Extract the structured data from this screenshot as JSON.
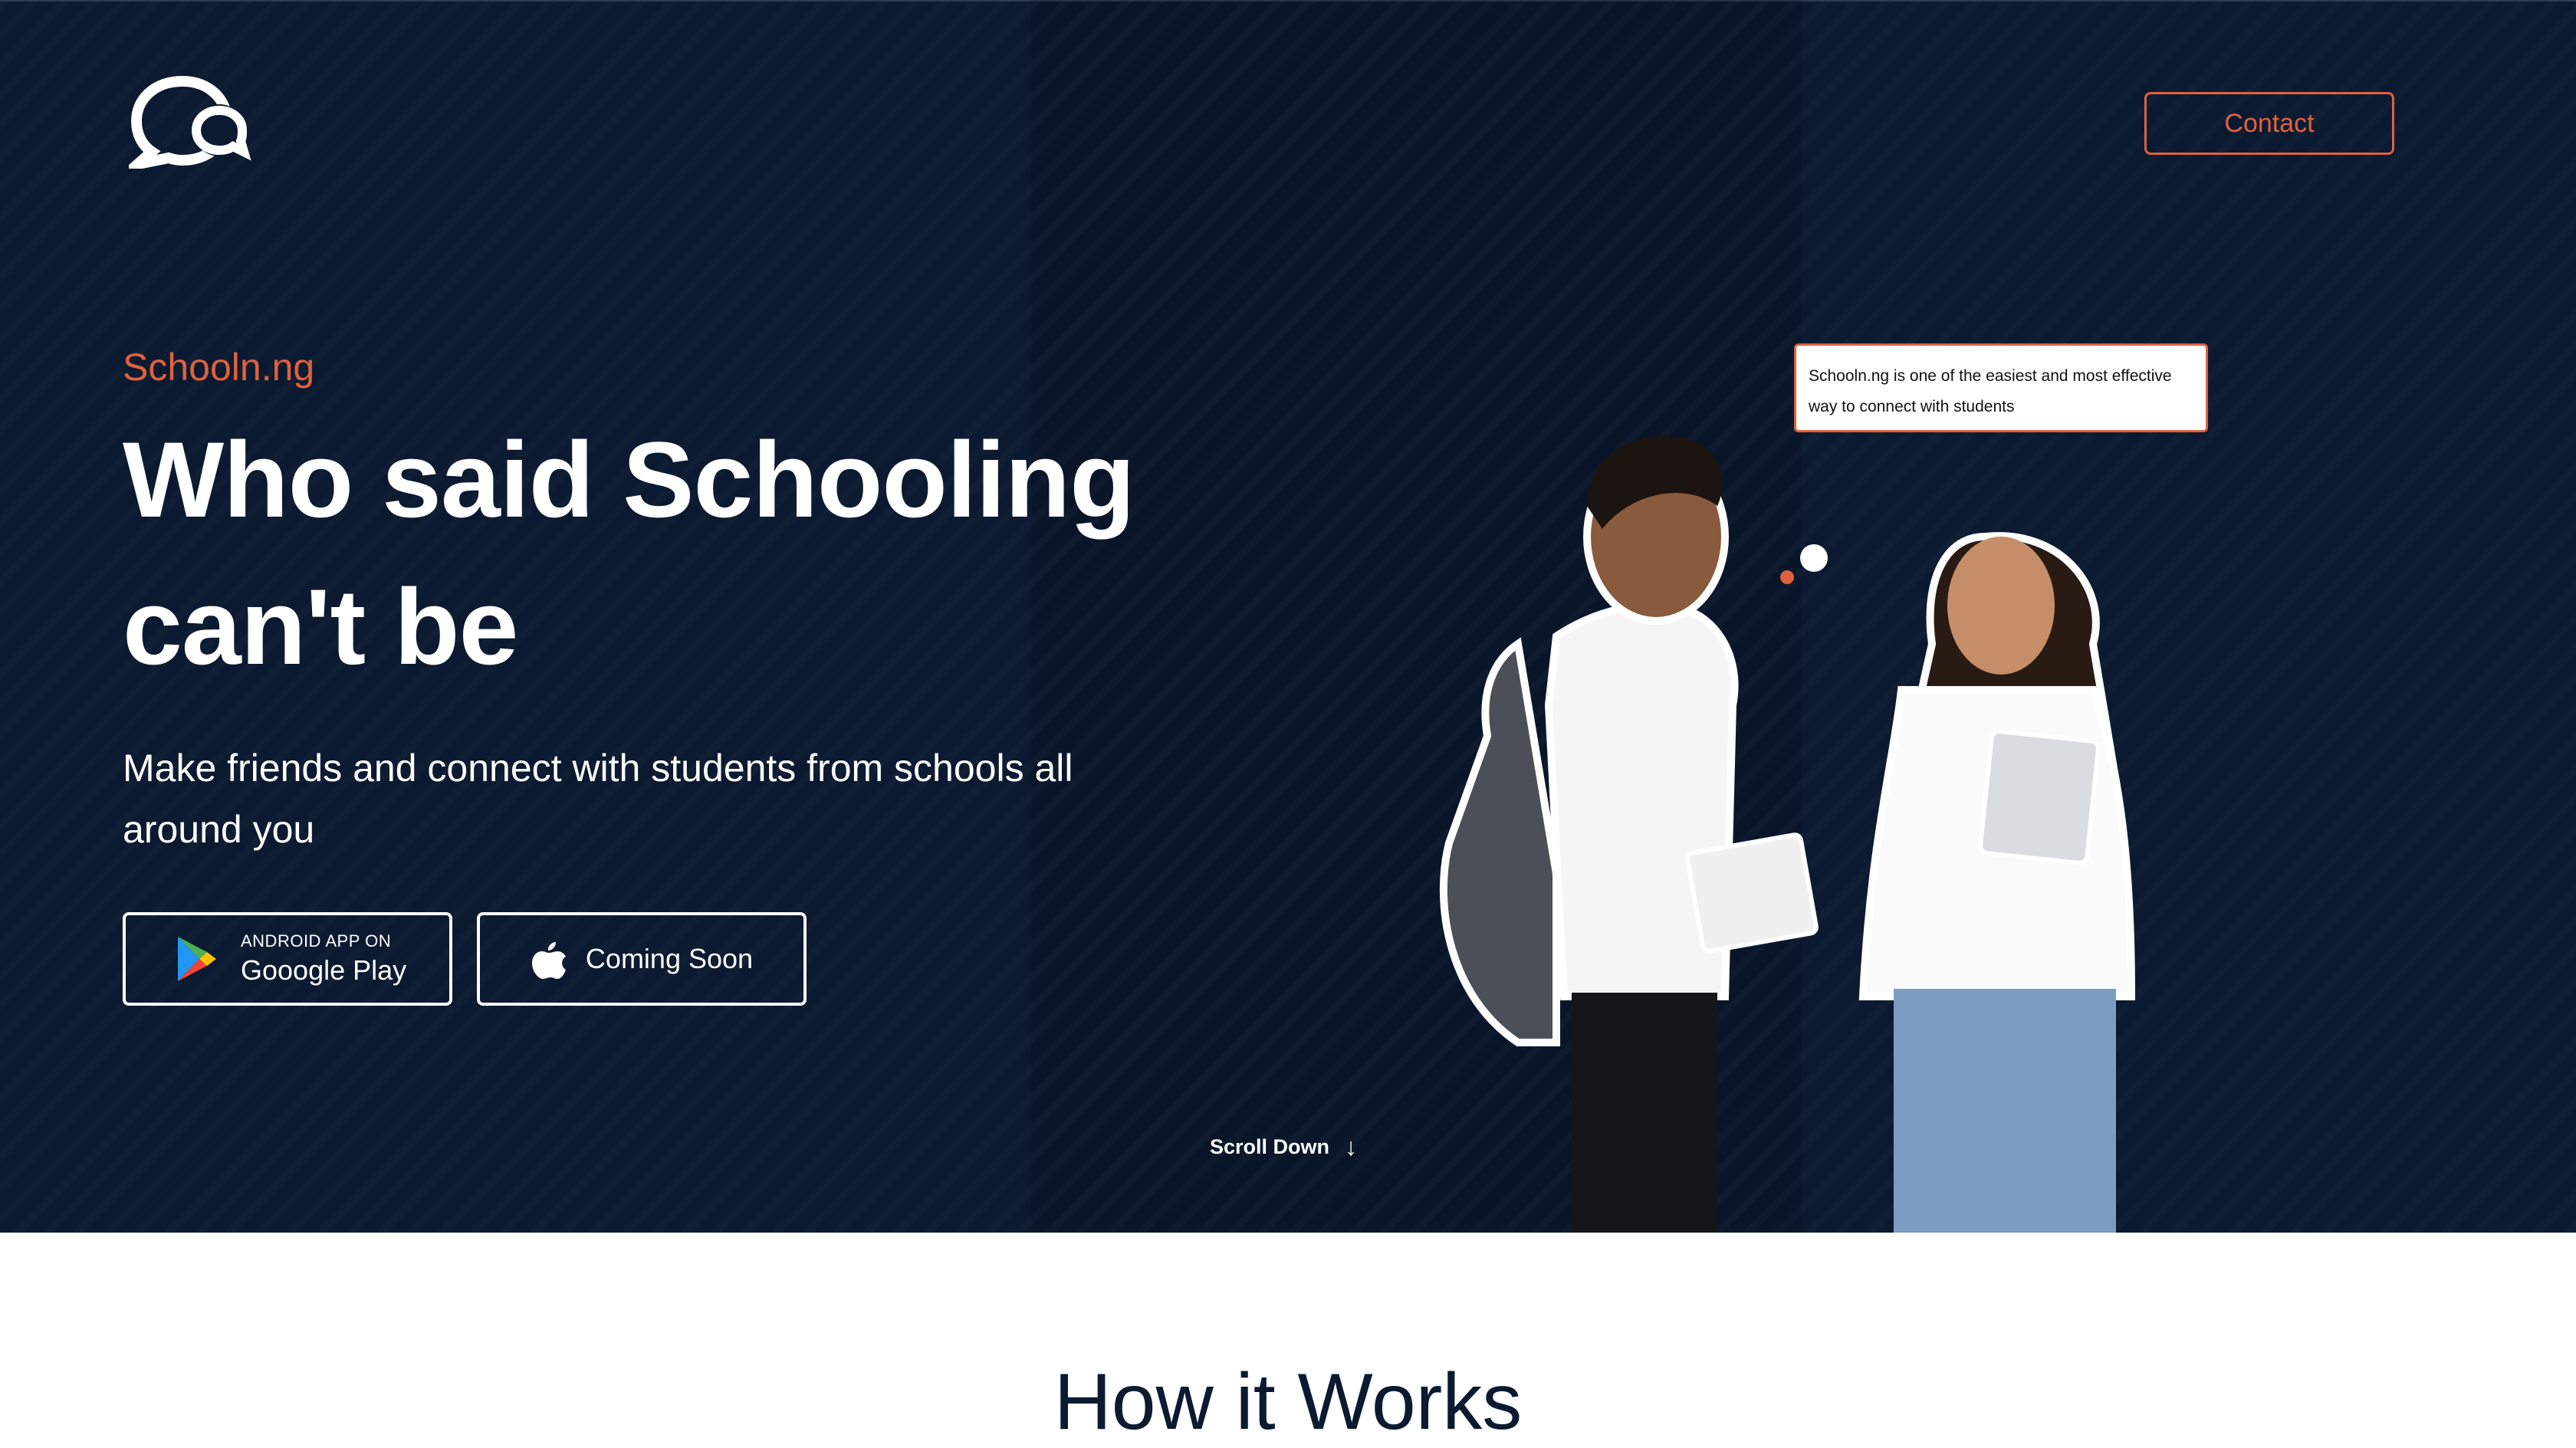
{
  "header": {
    "logo_icon": "chat-bubbles-logo",
    "contact_label": "Contact"
  },
  "hero": {
    "brand": "Schooln.ng",
    "headline_line1": "Who said Schooling",
    "headline_line2": "can't be",
    "subtext": "Make friends and connect with students from schools all around you",
    "android_small": "ANDROID APP ON",
    "android_big": "Gooogle Play",
    "ios_label": "Coming Soon",
    "scroll_label": "Scroll Down",
    "scroll_arrow": "↓",
    "tooltip": "Schooln.ng is one of the easiest and most effective way to connect with students"
  },
  "how": {
    "title": "How it Works"
  },
  "colors": {
    "background": "#0b1a30",
    "accent": "#e0613f",
    "text": "#ffffff"
  }
}
